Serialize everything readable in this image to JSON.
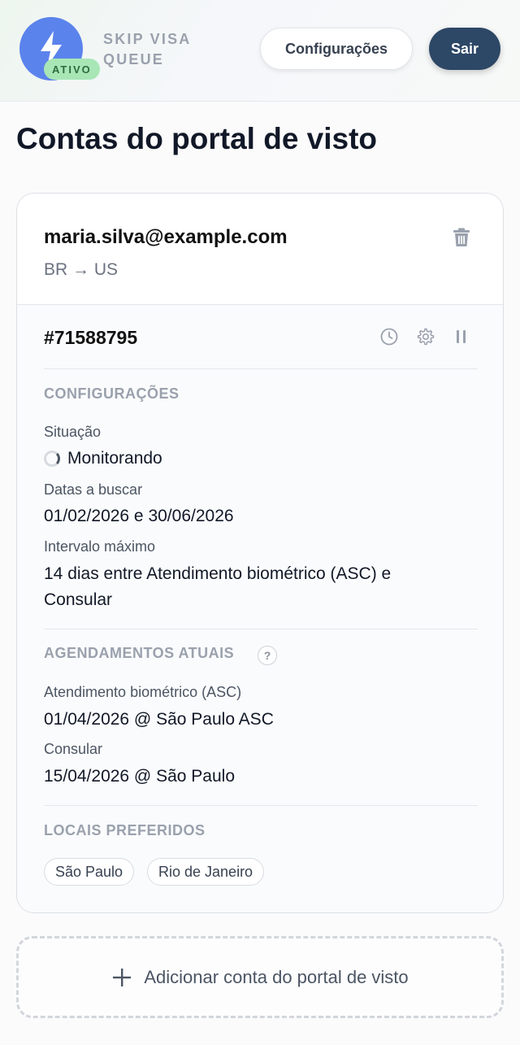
{
  "header": {
    "brand": "SKIP VISA QUEUE",
    "status_badge": "ATIVO",
    "config_label": "Configurações",
    "logout_label": "Sair",
    "logo_color": "#5b83ec"
  },
  "page": {
    "title": "Contas do portal de visto"
  },
  "account": {
    "email": "maria.silva@example.com",
    "route": "BR → US",
    "id": "#71588795",
    "settings": {
      "section_title": "CONFIGURAÇÕES",
      "status_label": "Situação",
      "status_value": "Monitorando",
      "dates_label": "Datas a buscar",
      "dates_value": "01/02/2026 e 30/06/2026",
      "interval_label": "Intervalo máximo",
      "interval_value": "14 dias entre Atendimento biométrico (ASC) e Consular"
    },
    "appointments": {
      "section_title": "AGENDAMENTOS ATUAIS",
      "help_glyph": "?",
      "asc_label": "Atendimento biométrico (ASC)",
      "asc_value": "01/04/2026 @ São Paulo ASC",
      "consular_label": "Consular",
      "consular_value": "15/04/2026 @ São Paulo"
    },
    "locations": {
      "section_title": "LOCAIS PREFERIDOS",
      "items": [
        "São Paulo",
        "Rio de Janeiro"
      ]
    }
  },
  "add_account": {
    "label": "Adicionar conta do portal de visto"
  },
  "icons": [
    "lightning-icon",
    "trash-icon",
    "clock-icon",
    "gear-icon",
    "pause-icon",
    "plus-icon",
    "help-icon",
    "spinner-icon"
  ]
}
